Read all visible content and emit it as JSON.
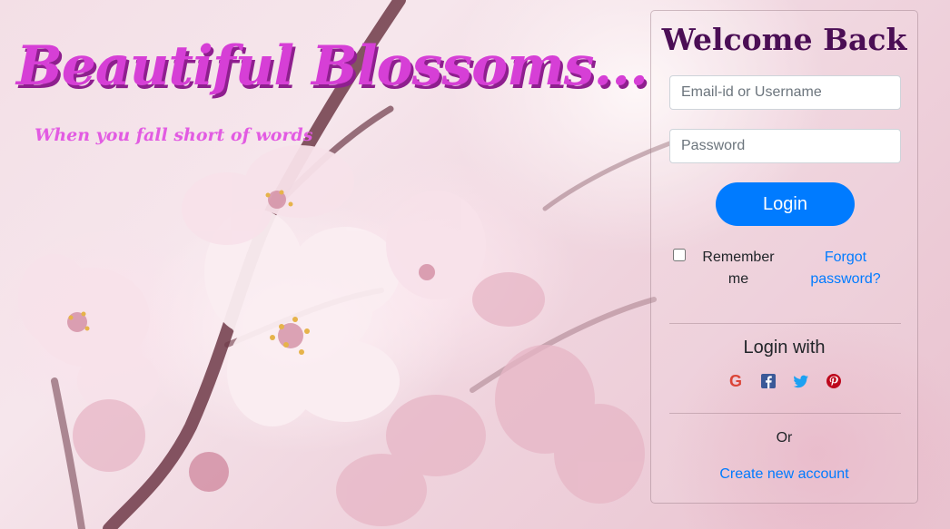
{
  "brand": {
    "title": "Beautiful Blossoms...",
    "subtitle": "When you fall short of words"
  },
  "login": {
    "heading": "Welcome Back",
    "email_placeholder": "Email-id or Username",
    "password_placeholder": "Password",
    "login_label": "Login",
    "remember_label": "Remember me",
    "remember_checked": false,
    "forgot_label": "Forgot password?",
    "login_with_label": "Login with",
    "social": [
      "google-icon",
      "facebook-icon",
      "twitter-icon",
      "pinterest-icon"
    ],
    "or_label": "Or",
    "create_account_label": "Create new account"
  },
  "colors": {
    "brand_pink": "#d63fd6",
    "heading_purple": "#4b0e55",
    "primary_blue": "#007bff",
    "google_red": "#db4437",
    "facebook_blue": "#3b5998",
    "twitter_blue": "#1da1f2",
    "pinterest_red": "#bd081c"
  }
}
